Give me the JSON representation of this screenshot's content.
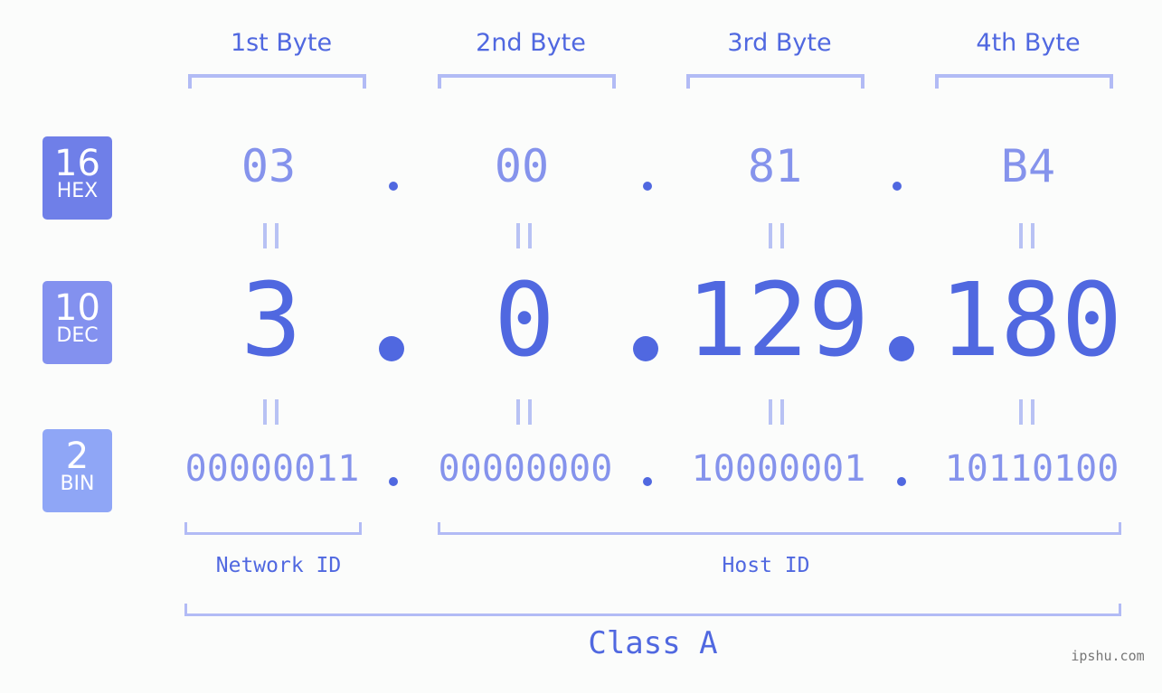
{
  "badges": [
    {
      "num": "16",
      "label": "HEX",
      "color": "#6f7fe8"
    },
    {
      "num": "10",
      "label": "DEC",
      "color": "#8391ef"
    },
    {
      "num": "2",
      "label": "BIN",
      "color": "#8fa6f6"
    }
  ],
  "bytes": [
    {
      "header": "1st Byte",
      "hex": "03",
      "dec": "3",
      "bin": "00000011"
    },
    {
      "header": "2nd Byte",
      "hex": "00",
      "dec": "0",
      "bin": "00000000"
    },
    {
      "header": "3rd Byte",
      "hex": "81",
      "dec": "129",
      "bin": "10000001"
    },
    {
      "header": "4th Byte",
      "hex": "B4",
      "dec": "180",
      "bin": "10110100"
    }
  ],
  "labels": {
    "network": "Network ID",
    "host": "Host ID",
    "class": "Class A"
  },
  "watermark": "ipshu.com",
  "colors": {
    "accent": "#5068e0",
    "light": "#8593ec",
    "bracket": "#b2bbf5"
  }
}
